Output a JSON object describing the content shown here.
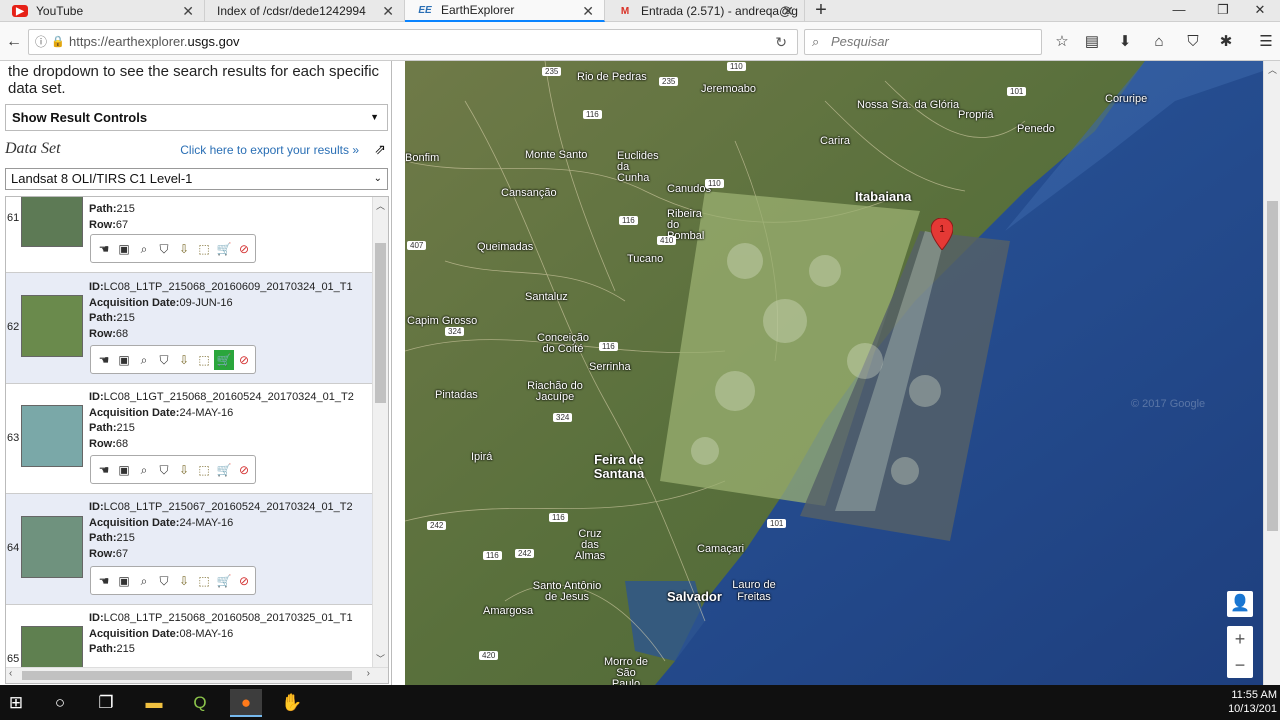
{
  "browser": {
    "tabs": [
      {
        "label": "YouTube",
        "icon": "youtube-icon"
      },
      {
        "label": "Index of /cdsr/dede1242994",
        "icon": "page-icon"
      },
      {
        "label": "EarthExplorer",
        "icon": "ee-icon",
        "icon_text": "EE"
      },
      {
        "label": "Entrada (2.571) - andreqa@g",
        "icon": "gmail-icon",
        "icon_text": "M"
      }
    ],
    "url_scheme": "https://earthexplorer.",
    "url_host": "usgs.gov",
    "search_placeholder": "Pesquisar"
  },
  "sidebar": {
    "intro_text": "the dropdown to see the search results for each specific data set.",
    "show_result_controls": "Show Result Controls",
    "data_set_label": "Data Set",
    "export_link": "Click here to export your results »",
    "data_set_value": "Landsat 8 OLI/TIRS C1 Level-1"
  },
  "results": [
    {
      "num": "61",
      "id": "",
      "acq_date": "",
      "path": "215",
      "row": "67",
      "selected_action": -1,
      "thumb_color": "#5d7a55"
    },
    {
      "num": "62",
      "id": "LC08_L1TP_215068_20160609_20170324_01_T1",
      "acq_date": "09-JUN-16",
      "path": "215",
      "row": "68",
      "selected_action": 6,
      "thumb_color": "#6a8a4c"
    },
    {
      "num": "63",
      "id": "LC08_L1GT_215068_20160524_20170324_01_T2",
      "acq_date": "24-MAY-16",
      "path": "215",
      "row": "68",
      "selected_action": -1,
      "thumb_color": "#7aa8a8"
    },
    {
      "num": "64",
      "id": "LC08_L1TP_215067_20160524_20170324_01_T2",
      "acq_date": "24-MAY-16",
      "path": "215",
      "row": "67",
      "selected_action": -1,
      "thumb_color": "#6f927e"
    },
    {
      "num": "65",
      "id": "LC08_L1TP_215068_20160508_20170325_01_T1",
      "acq_date": "08-MAY-16",
      "path": "215",
      "row": "",
      "selected_action": -1,
      "thumb_color": "#5f8050"
    }
  ],
  "labels": {
    "id": "ID:",
    "acq": "Acquisition Date:",
    "path": "Path:",
    "row": "Row:"
  },
  "map": {
    "places": [
      {
        "name": "Rio de Pedras"
      },
      {
        "name": "Jeremoabo"
      },
      {
        "name": "Nossa Sra. da Glória"
      },
      {
        "name": "Propriá"
      },
      {
        "name": "Penedo"
      },
      {
        "name": "Coruripe"
      },
      {
        "name": "Bonfim"
      },
      {
        "name": "Monte Santo"
      },
      {
        "name": "Euclides da Cunha"
      },
      {
        "name": "Carira"
      },
      {
        "name": "Canudos"
      },
      {
        "name": "Itabaiana"
      },
      {
        "name": "Cansanção"
      },
      {
        "name": "Ribeira do Pombal"
      },
      {
        "name": "Queimadas"
      },
      {
        "name": "Tucano"
      },
      {
        "name": "Santaluz"
      },
      {
        "name": "Capim Grosso"
      },
      {
        "name": "Conceição do Coité"
      },
      {
        "name": "Serrinha"
      },
      {
        "name": "Pintadas"
      },
      {
        "name": "Riachão do Jacuípe"
      },
      {
        "name": "Ipirá"
      },
      {
        "name": "Feira de Santana",
        "big": true
      },
      {
        "name": "Cruz das Almas"
      },
      {
        "name": "Camaçari"
      },
      {
        "name": "Santo Antônio de Jesus"
      },
      {
        "name": "Lauro de Freitas"
      },
      {
        "name": "Salvador",
        "big": true
      },
      {
        "name": "Amargosa"
      },
      {
        "name": "Morro de São Paulo"
      }
    ],
    "roads": [
      "235",
      "110",
      "235",
      "101",
      "116",
      "110",
      "410",
      "407",
      "116",
      "324",
      "116",
      "324",
      "242",
      "116",
      "242",
      "116",
      "101",
      "420"
    ],
    "watermark": "© 2017 Google"
  },
  "taskbar": {
    "time": "11:55 AM",
    "date": "10/13/201"
  }
}
